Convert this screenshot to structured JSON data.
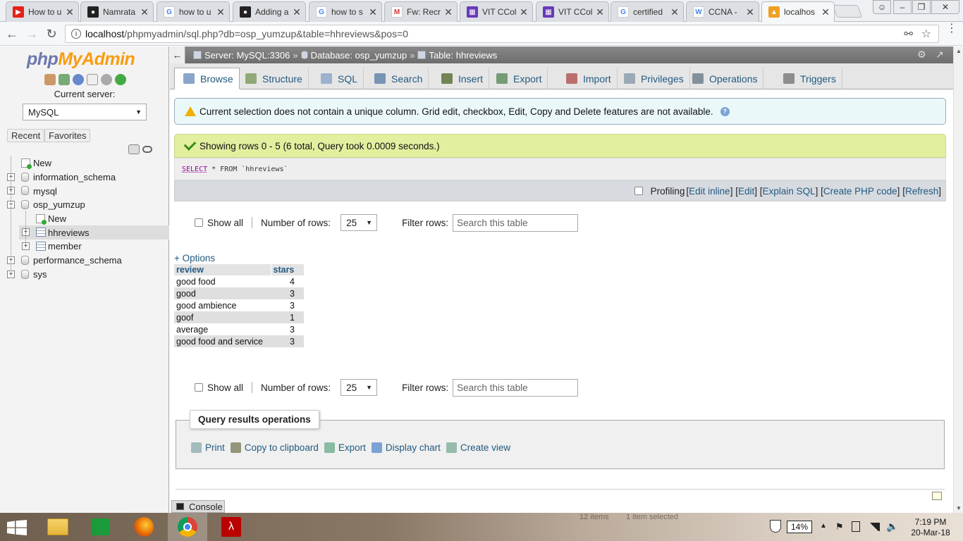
{
  "browser": {
    "tabs": [
      {
        "title": "How to u",
        "favicon": "youtube-icon"
      },
      {
        "title": "Namrata",
        "favicon": "github-icon"
      },
      {
        "title": "how to u",
        "favicon": "google-icon"
      },
      {
        "title": "Adding a",
        "favicon": "github-icon"
      },
      {
        "title": "how to s",
        "favicon": "google-icon"
      },
      {
        "title": "Fw: Recr",
        "favicon": "gmail-icon"
      },
      {
        "title": "VIT CCol",
        "favicon": "vit-icon"
      },
      {
        "title": "VIT CCol",
        "favicon": "vit-icon"
      },
      {
        "title": "certified",
        "favicon": "google-icon"
      },
      {
        "title": "CCNA -",
        "favicon": "wikipedia-icon"
      },
      {
        "title": "localhos",
        "favicon": "phpmyadmin-icon",
        "active": true
      }
    ],
    "url_host": "localhost",
    "url_path": "/phpmyadmin/sql.php?db=osp_yumzup&table=hhreviews&pos=0"
  },
  "sidebar": {
    "logo_php": "php",
    "logo_myadmin": "MyAdmin",
    "current_server_label": "Current server:",
    "server_select": "MySQL",
    "recent": "Recent",
    "favorites": "Favorites",
    "tree": [
      {
        "label": "New",
        "type": "new",
        "level": 0
      },
      {
        "label": "information_schema",
        "type": "db",
        "level": 0
      },
      {
        "label": "mysql",
        "type": "db",
        "level": 0
      },
      {
        "label": "osp_yumzup",
        "type": "db",
        "level": 0,
        "expanded": true
      },
      {
        "label": "New",
        "type": "new",
        "level": 1
      },
      {
        "label": "hhreviews",
        "type": "table",
        "level": 1,
        "selected": true
      },
      {
        "label": "member",
        "type": "table",
        "level": 1
      },
      {
        "label": "performance_schema",
        "type": "db",
        "level": 0
      },
      {
        "label": "sys",
        "type": "db",
        "level": 0
      }
    ]
  },
  "topbar": {
    "server": "Server: MySQL:3306",
    "database": "Database: osp_yumzup",
    "table": "Table: hhreviews"
  },
  "tabs": [
    {
      "label": "Browse",
      "icon": "browse-icon",
      "color": "#6c8ebf",
      "active": true
    },
    {
      "label": "Structure",
      "icon": "structure-icon",
      "color": "#7a9a5a"
    },
    {
      "label": "SQL",
      "icon": "sql-icon",
      "color": "#8aa4c8"
    },
    {
      "label": "Search",
      "icon": "search-icon",
      "color": "#5b7fa8"
    },
    {
      "label": "Insert",
      "icon": "insert-icon",
      "color": "#556b2f"
    },
    {
      "label": "Export",
      "icon": "export-icon",
      "color": "#5a8a5a"
    },
    {
      "label": "Import",
      "icon": "import-icon",
      "color": "#b05050"
    },
    {
      "label": "Privileges",
      "icon": "privileges-icon",
      "color": "#8899aa"
    },
    {
      "label": "Operations",
      "icon": "operations-icon",
      "color": "#6a7a8a"
    },
    {
      "label": "Triggers",
      "icon": "triggers-icon",
      "color": "#777777"
    }
  ],
  "notice": {
    "text": "Current selection does not contain a unique column. Grid edit, checkbox, Edit, Copy and Delete features are not available."
  },
  "success": {
    "text": "Showing rows 0 - 5 (6 total, Query took 0.0009 seconds.)"
  },
  "sql": {
    "keyword": "SELECT",
    "rest": " * FROM `hhreviews`"
  },
  "profiling": {
    "label": "Profiling",
    "links": [
      "Edit inline",
      "Edit",
      "Explain SQL",
      "Create PHP code",
      "Refresh"
    ]
  },
  "controls": {
    "show_all": "Show all",
    "number_of_rows_label": "Number of rows:",
    "number_of_rows_value": "25",
    "filter_label": "Filter rows:",
    "filter_placeholder": "Search this table"
  },
  "options_link": "+ Options",
  "results": {
    "columns": [
      "review",
      "stars"
    ],
    "rows": [
      [
        "good food",
        "4"
      ],
      [
        "good",
        "3"
      ],
      [
        "good ambience",
        "3"
      ],
      [
        "goof",
        "1"
      ],
      [
        "average",
        "3"
      ],
      [
        "good food and service",
        "3"
      ]
    ]
  },
  "query_ops": {
    "legend": "Query results operations",
    "items": [
      {
        "label": "Print",
        "icon": "print-icon"
      },
      {
        "label": "Copy to clipboard",
        "icon": "clipboard-icon"
      },
      {
        "label": "Export",
        "icon": "export-icon"
      },
      {
        "label": "Display chart",
        "icon": "chart-icon"
      },
      {
        "label": "Create view",
        "icon": "view-icon"
      }
    ]
  },
  "console_label": "Console",
  "taskbar": {
    "battery": "14%",
    "time": "7:19 PM",
    "date": "20-Mar-18",
    "ghost_left": "12 items",
    "ghost_right": "1 item selected"
  }
}
